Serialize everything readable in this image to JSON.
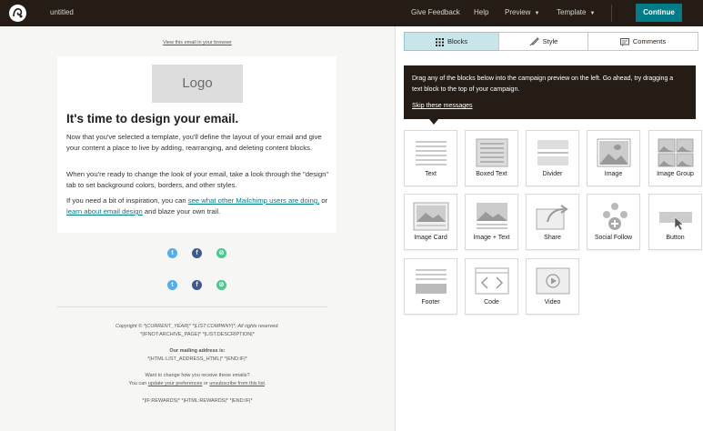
{
  "topbar": {
    "title": "untitled",
    "give_feedback": "Give Feedback",
    "help": "Help",
    "preview": "Preview",
    "template": "Template",
    "continue": "Continue",
    "brand_color": "#241c15",
    "accent_color": "#007c89"
  },
  "preview": {
    "view_link": "View this email in your browser",
    "logo_placeholder": "Logo",
    "heading": "It's time to design your email.",
    "p1": "Now that you've selected a template, you'll define the layout of your email and give your content a place to live by adding, rearranging, and deleting content blocks.",
    "p2": "When you're ready to change the look of your email, take a look through the \"design\" tab to set background colors, borders, and other styles.",
    "p3_before": "If you need a bit of inspiration, you can ",
    "p3_link1": "see what other Mailchimp users are doing,",
    "p3_mid": " or ",
    "p3_link2": "learn about email design",
    "p3_after": " and blaze your own trail.",
    "social_icons": [
      "twitter-icon",
      "facebook-icon",
      "link-icon"
    ]
  },
  "footer": {
    "copyright": "Copyright © *|CURRENT_YEAR|* *|LIST:COMPANY|*, All rights reserved.",
    "archive": "*|IFNOT:ARCHIVE_PAGE|* *|LIST:DESCRIPTION|*",
    "address_label": "Our mailing address is:",
    "address": "*|HTML:LIST_ADDRESS_HTML|* *|END:IF|*",
    "change_q": "Want to change how you receive these emails?",
    "change_before": "You can ",
    "update_prefs": "update your preferences",
    "change_or": " or ",
    "unsubscribe": "unsubscribe from this list",
    "change_end": ".",
    "rewards": "*|IF:REWARDS|* *|HTML:REWARDS|* *|END:IF|*"
  },
  "panel": {
    "tabs": [
      "Blocks",
      "Style",
      "Comments"
    ],
    "active_tab": "Blocks",
    "tip_text": "Drag any of the blocks below into the campaign preview on the left. Go ahead, try dragging a text block to the top of your campaign.",
    "tip_skip": "Skip these messages",
    "blocks": [
      "Text",
      "Boxed Text",
      "Divider",
      "Image",
      "Image Group",
      "Image Card",
      "Image + Text",
      "Share",
      "Social Follow",
      "Button",
      "Footer",
      "Code",
      "Video"
    ]
  }
}
